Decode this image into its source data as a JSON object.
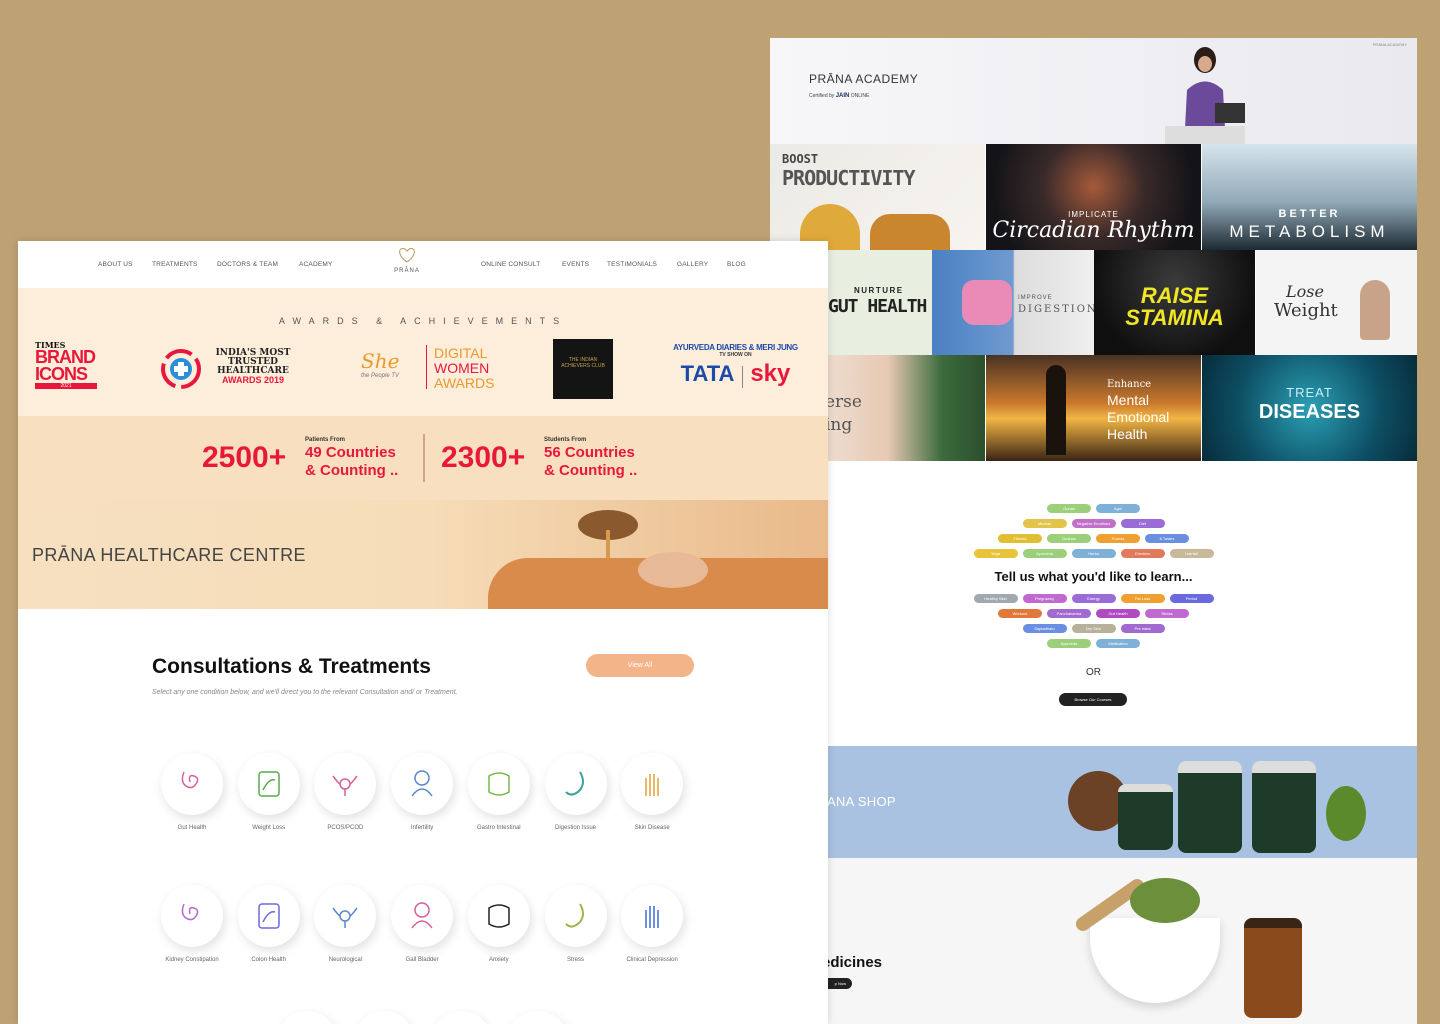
{
  "academy": {
    "title": "PRĀNA ACADEMY",
    "certified": "Certified by",
    "certifier": "JAIN",
    "certifier_sub": "ONLINE",
    "corner_logo": "PRĀNA ACADEMY",
    "tiles": {
      "boost": "BOOST",
      "productivity": "PRODUCTIVITY",
      "implicate": "IMPLICATE",
      "circadian": "Circadian Rhythm",
      "better": "BETTER",
      "metabolism": "METABOLISM",
      "nurture": "NURTURE",
      "gut_health": "GUT HEALTH",
      "improve": "IMPROVE",
      "digestion": "DIGESTION",
      "raise": "RAISE",
      "stamina": "STAMINA",
      "lose": "Lose",
      "weight": "Weight",
      "reverse_frag": "erse",
      "aging_frag": "ing",
      "enhance": "Enhance",
      "mental": "Mental",
      "emotional": "Emotional",
      "health": "Health",
      "treat": "TREAT",
      "diseases": "DISEASES"
    },
    "tags_top": [
      "Gunas",
      "Agni",
      "Mudras",
      "Negative Emotions",
      "Diet",
      "Fitness",
      "Doshas",
      "Pranas",
      "6 Tastes",
      "Yoga",
      "Ayurveda",
      "Herbs",
      "Emotion",
      "Hairfall"
    ],
    "tell_us": "Tell us what you'd like to learn...",
    "tags_bottom": [
      "Healthy Skin",
      "Pregnancy",
      "Energy",
      "Fat Loss",
      "Period",
      "Workout",
      "Panchakarma",
      "Gut Health",
      "Stress",
      "Saptadhatu",
      "Dry Skin",
      "Pre natal",
      "Ayurveda",
      "Medication"
    ],
    "or": "OR",
    "browse": "Browse Our Courses",
    "shop": "ANA SHOP",
    "medicines": "edicines",
    "shop_now": "p Now"
  },
  "healthcare": {
    "nav_left": [
      "ABOUT US",
      "TREATMENTS",
      "DOCTORS & TEAM",
      "ACADEMY"
    ],
    "logo": "PRĀNA",
    "nav_right": [
      "ONLINE CONSULT",
      "EVENTS",
      "TESTIMONIALS",
      "GALLERY",
      "BLOG"
    ],
    "awards_heading": "AWARDS & ACHIEVEMENTS",
    "awards": {
      "times": "TIMES",
      "brand": "BRAND",
      "icons": "ICONS",
      "year": "2021",
      "trusted1": "INDIA'S MOST",
      "trusted2": "TRUSTED",
      "trusted3": "HEALTHCARE",
      "trusted4": "AWARDS 2019",
      "she1": "She",
      "she2": "the People TV",
      "digital1": "DIGITAL",
      "digital2": "WOMEN",
      "digital3": "AWARDS",
      "club": "THE INDIAN ACHIEVERS CLUB",
      "diaries": "AYURVEDA DIARIES & MERI JUNG",
      "tvshow": "TV SHOW ON",
      "tata": "TATA",
      "sky": "sky"
    },
    "stats": [
      {
        "big": "2500+",
        "from": "Patients From",
        "line1": "49 Countries",
        "line2": "& Counting .."
      },
      {
        "big": "2300+",
        "from": "Students From",
        "line1": "56 Countries",
        "line2": "& Counting .."
      }
    ],
    "centre": "PRĀNA HEALTHCARE CENTRE",
    "consult_title": "Consultations & Treatments",
    "consult_sub": "Select any one condition below, and we'll direct you to the relevant Consultation and/ or Treatment.",
    "view_all": "View All",
    "row1": [
      "Gut Health",
      "Weight Loss",
      "PCOS/PCOD",
      "Infertility",
      "Gastro Intestinal",
      "Digestion Issue",
      "Skin Disease"
    ],
    "row2": [
      "Kidney Constipation",
      "Colon Health",
      "Neurological",
      "Gall Bladder",
      "Anxiety",
      "Stress",
      "Clinical Depression"
    ]
  }
}
